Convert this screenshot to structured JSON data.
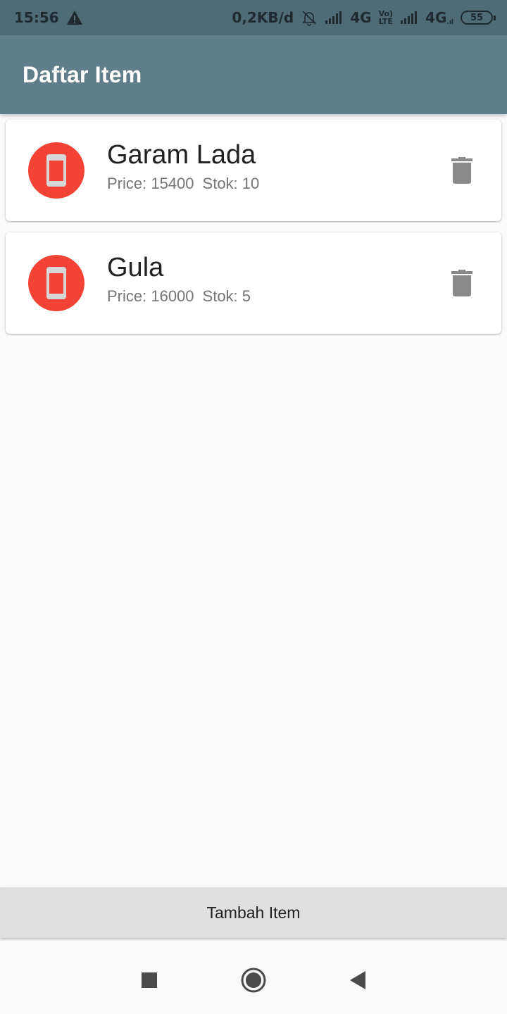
{
  "status_bar": {
    "time": "15:56",
    "data_rate": "0,2KB/d",
    "network_1": "4G",
    "volte_top": "Vo)",
    "volte_bottom": "LTE",
    "network_2": "4G",
    "network_2_suffix": ".ıl",
    "battery": "55",
    "icons": [
      "warning-icon",
      "bell-off-icon",
      "signal-icon",
      "signal-icon",
      "battery-icon"
    ]
  },
  "app_bar": {
    "title": "Daftar Item"
  },
  "items": [
    {
      "name": "Garam Lada",
      "price_label": "Price: 15400",
      "stock_label": "Stok: 10",
      "icon": "phone-icon",
      "action_icon": "trash-icon"
    },
    {
      "name": "Gula",
      "price_label": "Price: 16000",
      "stock_label": "Stok: 5",
      "icon": "phone-icon",
      "action_icon": "trash-icon"
    }
  ],
  "add_button": {
    "label": "Tambah Item"
  },
  "nav_bar": {
    "icons": [
      "recents-icon",
      "home-icon",
      "back-icon"
    ]
  },
  "colors": {
    "status_bar": "#4f6b77",
    "app_bar": "#607d8b",
    "avatar": "#f44336",
    "background": "#fafafa",
    "button": "#e0e0e0"
  }
}
